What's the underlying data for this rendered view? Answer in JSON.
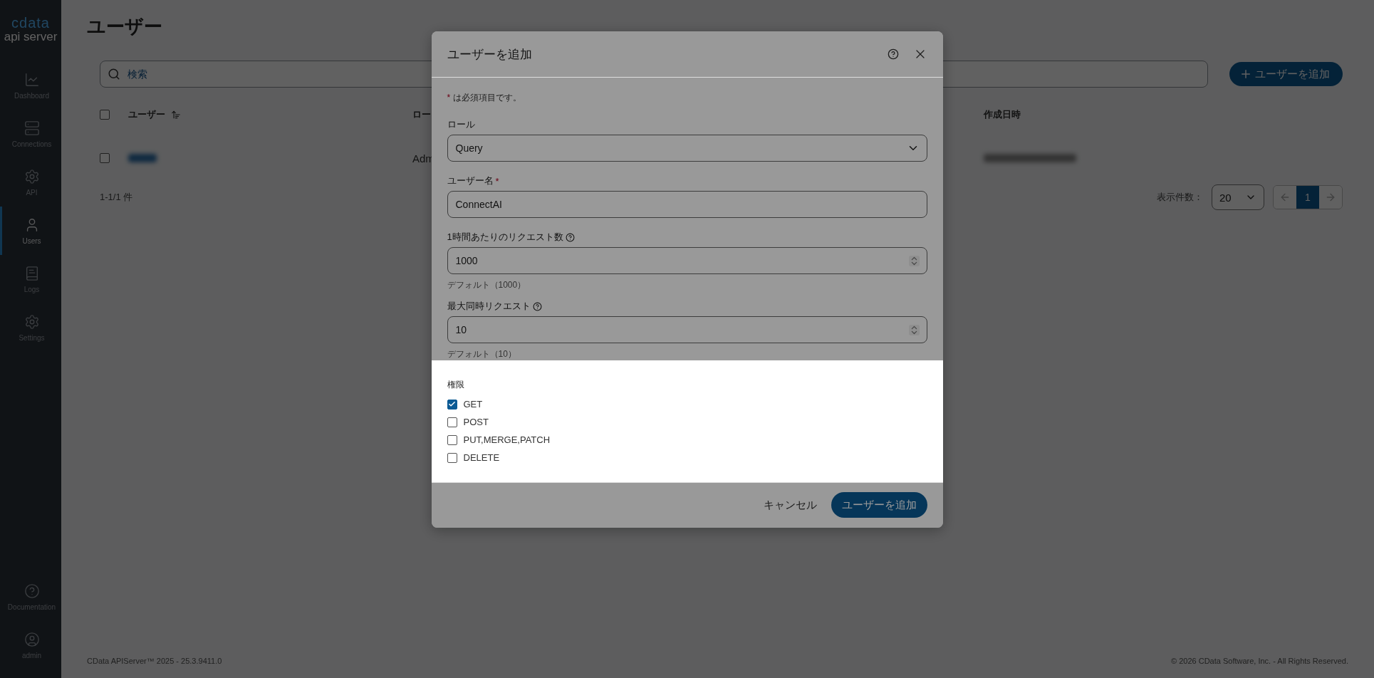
{
  "sidebar": {
    "logo": {
      "brand": "cdata",
      "product": "api server"
    },
    "items": [
      {
        "label": "Dashboard",
        "selected": false
      },
      {
        "label": "Connections",
        "selected": false
      },
      {
        "label": "API",
        "selected": false
      },
      {
        "label": "Users",
        "selected": true
      },
      {
        "label": "Logs",
        "selected": false
      },
      {
        "label": "Settings",
        "selected": false
      }
    ],
    "bottom_items": [
      {
        "label": "Documentation"
      },
      {
        "label": "admin"
      }
    ]
  },
  "page": {
    "title": "ユーザー",
    "search": {
      "placeholder": "検索"
    },
    "add_button": {
      "label": "ユーザーを追加"
    },
    "table": {
      "header_checked": false,
      "columns": [
        {
          "label": "ユーザー",
          "sorted": true
        },
        {
          "label": "ロー",
          "sorted": false
        },
        {
          "label": "作成日時",
          "sorted": false
        }
      ],
      "rows": [
        {
          "checked": false,
          "cells": [
            {
              "kind": "redacted"
            },
            {
              "kind": "text",
              "text": "Adm"
            },
            {
              "kind": "redacted"
            }
          ]
        }
      ]
    },
    "pagination": {
      "summary": "1-1/1 件",
      "page_size_label": "表示件数：",
      "page_size": "20",
      "pages": [
        {
          "label": "1",
          "selected": true
        }
      ]
    }
  },
  "footer": {
    "left": "CData APIServer™ 2025 - 25.3.9411.0",
    "right": "© 2026 CData Software, Inc. - All Rights Reserved."
  },
  "dialog": {
    "title": "ユーザーを追加",
    "required_mark": "*",
    "required_note": "は必須項目です。",
    "fields": [
      {
        "kind": "select",
        "label": "ロール",
        "value": "Query",
        "help": false
      },
      {
        "kind": "text",
        "label": "ユーザー名",
        "required_mark": "*",
        "value": "ConnectAI",
        "help": false
      },
      {
        "kind": "number",
        "label": "1時間あたりのリクエスト数",
        "help": true,
        "value": "1000",
        "hint": "デフォルト（1000）"
      },
      {
        "kind": "number",
        "label": "最大同時リクエスト",
        "help": true,
        "value": "10",
        "hint": "デフォルト（10）"
      }
    ],
    "permissions": {
      "label": "権限",
      "options": [
        {
          "label": "GET",
          "checked": true
        },
        {
          "label": "POST",
          "checked": false
        },
        {
          "label": "PUT,MERGE,PATCH",
          "checked": false
        },
        {
          "label": "DELETE",
          "checked": false
        }
      ]
    },
    "cancel": "キャンセル",
    "submit": "ユーザーを追加"
  }
}
